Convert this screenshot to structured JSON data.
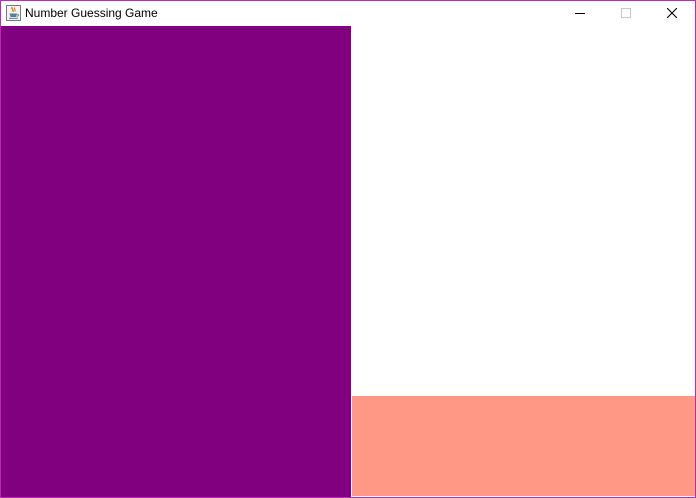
{
  "window": {
    "title": "Number Guessing Game",
    "icon": "java-coffee-cup-icon",
    "border_color": "#b92ab9"
  },
  "controls": {
    "minimize_icon": "minimize-icon",
    "maximize_icon": "maximize-icon",
    "close_icon": "close-icon"
  },
  "colors": {
    "left_panel": "#800080",
    "right_panel": "#ffffff",
    "bottom_panel": "#ff9985"
  }
}
